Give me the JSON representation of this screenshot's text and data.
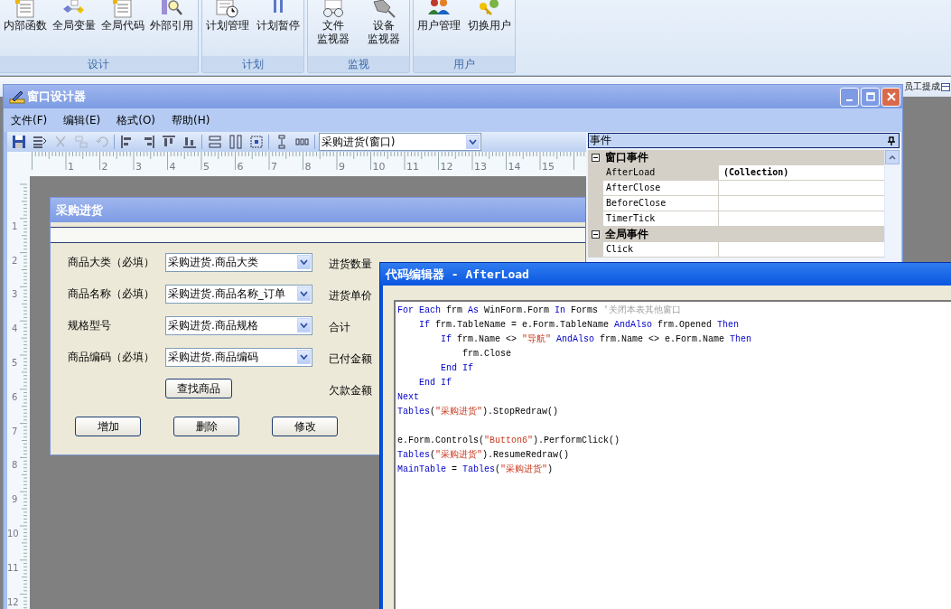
{
  "ribbon": {
    "groups": [
      {
        "label": "设计",
        "buttons": [
          {
            "lines": [
              "内部函数"
            ]
          },
          {
            "lines": [
              "全局变量"
            ]
          },
          {
            "lines": [
              "全局代码"
            ]
          },
          {
            "lines": [
              "外部引用"
            ]
          }
        ]
      },
      {
        "label": "计划",
        "buttons": [
          {
            "lines": [
              "计划管理"
            ]
          },
          {
            "lines": [
              "计划暂停"
            ]
          }
        ]
      },
      {
        "label": "监视",
        "buttons": [
          {
            "lines": [
              "文件",
              "监视器"
            ]
          },
          {
            "lines": [
              "设备",
              "监视器"
            ]
          }
        ]
      },
      {
        "label": "用户",
        "buttons": [
          {
            "lines": [
              "用户管理"
            ]
          },
          {
            "lines": [
              "切换用户"
            ]
          }
        ]
      }
    ]
  },
  "tab_strip": {
    "tabs": [
      {
        "label": "员工提成"
      }
    ]
  },
  "designer": {
    "title": "窗口设计器",
    "menu": [
      "文件(F)",
      "编辑(E)",
      "格式(O)",
      "帮助(H)"
    ],
    "toolbar": [
      {
        "disabled": false
      },
      {
        "disabled": false
      },
      {
        "disabled": true
      },
      {
        "disabled": true
      },
      {
        "disabled": true
      },
      {
        "disabled": false
      },
      {
        "disabled": false
      },
      {
        "disabled": false
      },
      {
        "disabled": false
      },
      {
        "disabled": false
      },
      {
        "disabled": false
      },
      {
        "disabled": false
      },
      {
        "disabled": false
      },
      {
        "disabled": false
      }
    ],
    "form_selector": "采购进货(窗口)",
    "ruler_h": [
      "1",
      "2",
      "3",
      "4",
      "5",
      "6",
      "7",
      "8",
      "9",
      "10",
      "11",
      "12",
      "13",
      "14",
      "15"
    ],
    "ruler_v": [
      "1",
      "2",
      "3",
      "4",
      "5",
      "6",
      "7",
      "8",
      "9",
      "10",
      "11",
      "12"
    ]
  },
  "form": {
    "title": "采购进货",
    "fields": [
      {
        "label": "商品大类（必填）",
        "value": "采购进货.商品大类"
      },
      {
        "label": "商品名称（必填）",
        "value": "采购进货.商品名称_订单"
      },
      {
        "label": "规格型号",
        "value": "采购进货.商品规格"
      },
      {
        "label": "商品编码（必填）",
        "value": "采购进货.商品编码"
      }
    ],
    "find_button": "查找商品",
    "right_labels": [
      "进货数量",
      "进货单价",
      "合计",
      "已付金额",
      "欠款金额"
    ],
    "buttons": [
      "增加",
      "删除",
      "修改"
    ]
  },
  "properties": {
    "title": "事件",
    "groups": [
      {
        "label": "窗口事件",
        "expanded": true,
        "rows": [
          {
            "name": "AfterLoad",
            "value": "(Collection)",
            "selected": true
          },
          {
            "name": "AfterClose",
            "selected": false
          },
          {
            "name": "BeforeClose",
            "selected": false
          },
          {
            "name": "TimerTick",
            "selected": false
          }
        ]
      },
      {
        "label": "全局事件",
        "expanded": true,
        "rows": [
          {
            "name": "Click",
            "selected": false
          }
        ]
      }
    ]
  },
  "code_editor": {
    "title": "代码编辑器 - AfterLoad",
    "lines": [
      [
        {
          "kind": "kw",
          "text": "For Each"
        },
        {
          "kind": "plain",
          "text": " frm "
        },
        {
          "kind": "kw",
          "text": "As"
        },
        {
          "kind": "plain",
          "text": " WinForm.Form "
        },
        {
          "kind": "kw",
          "text": "In"
        },
        {
          "kind": "plain",
          "text": " Forms "
        },
        {
          "kind": "comment",
          "text": "'关闭本表其他窗口"
        }
      ],
      [
        {
          "kind": "kw",
          "text": "    If"
        },
        {
          "kind": "plain",
          "text": " frm.TableName = e.Form.TableName "
        },
        {
          "kind": "kw",
          "text": "AndAlso"
        },
        {
          "kind": "plain",
          "text": " frm.Opened "
        },
        {
          "kind": "kw",
          "text": "Then"
        }
      ],
      [
        {
          "kind": "kw",
          "text": "        If"
        },
        {
          "kind": "plain",
          "text": " frm.Name <> "
        },
        {
          "kind": "str",
          "text": "\"导航\""
        },
        {
          "kind": "kw",
          "text": " AndAlso"
        },
        {
          "kind": "plain",
          "text": " frm.Name <> e.Form.Name "
        },
        {
          "kind": "kw",
          "text": "Then"
        }
      ],
      [
        {
          "kind": "plain",
          "text": "            frm.Close"
        }
      ],
      [
        {
          "kind": "kw",
          "text": "        End If"
        }
      ],
      [
        {
          "kind": "kw",
          "text": "    End If"
        }
      ],
      [
        {
          "kind": "kw",
          "text": "Next"
        }
      ],
      [
        {
          "kind": "kw",
          "text": "Tables"
        },
        {
          "kind": "plain",
          "text": "("
        },
        {
          "kind": "str",
          "text": "\"采购进货\""
        },
        {
          "kind": "plain",
          "text": ").StopRedraw()"
        }
      ],
      [
        {
          "kind": "blank"
        }
      ],
      [
        {
          "kind": "plain",
          "text": "e.Form.Controls("
        },
        {
          "kind": "str",
          "text": "\"Button6\""
        },
        {
          "kind": "plain",
          "text": ").PerformClick()"
        }
      ],
      [
        {
          "kind": "kw",
          "text": "Tables"
        },
        {
          "kind": "plain",
          "text": "("
        },
        {
          "kind": "str",
          "text": "\"采购进货\""
        },
        {
          "kind": "plain",
          "text": ").ResumeRedraw()"
        }
      ],
      [
        {
          "kind": "kw",
          "text": "MainTable"
        },
        {
          "kind": "plain",
          "text": " = "
        },
        {
          "kind": "kw",
          "text": "Tables"
        },
        {
          "kind": "plain",
          "text": "("
        },
        {
          "kind": "str",
          "text": "\"采购进货\""
        },
        {
          "kind": "plain",
          "text": ")"
        }
      ]
    ]
  }
}
